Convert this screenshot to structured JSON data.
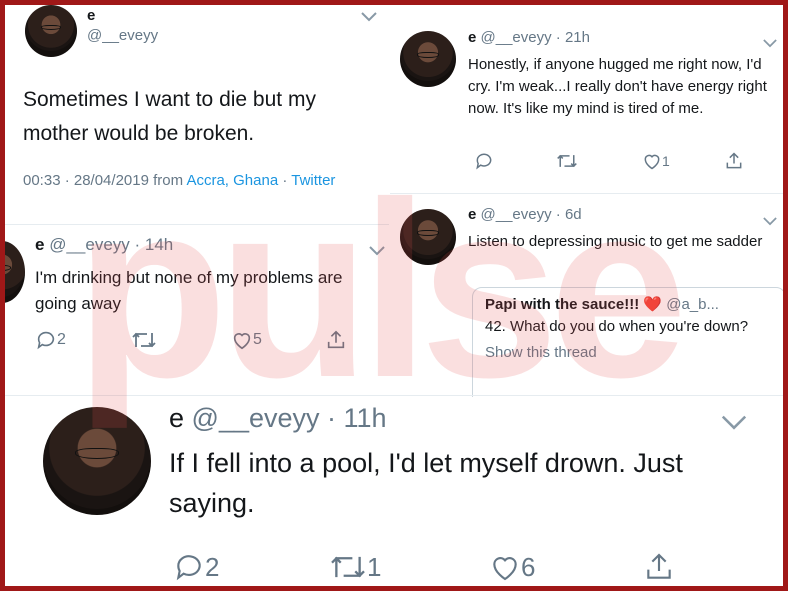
{
  "tweet_main": {
    "name": "e",
    "handle": "@__eveyy",
    "text": "Sometimes I want to die but my mother would be broken.",
    "time": "00:33 · 28/04/2019 from",
    "location": "Accra, Ghana",
    "sep": "·",
    "source": "Twitter"
  },
  "tweet_hug": {
    "name": "e",
    "meta": "@__eveyy · 21h",
    "text": "Honestly, if anyone hugged me right now, I'd cry. I'm weak...I really don't have energy right now. It's like my mind is tired of me.",
    "likes": "1"
  },
  "tweet_drinking": {
    "name": "e",
    "meta": "@__eveyy · 14h",
    "text": "I'm drinking but none of my problems are going away",
    "replies": "2",
    "likes": "5"
  },
  "tweet_music": {
    "name": "e",
    "meta": "@__eveyy · 6d",
    "text": "Listen to depressing music to get me sadder",
    "quote": {
      "author": "Papi with the sauce!!! ❤️",
      "handle": "@a_b...",
      "text": "42. What do you do when you're down?",
      "show_thread": "Show this thread"
    }
  },
  "tweet_pool": {
    "name": "e",
    "meta": "@__eveyy · 11h",
    "text": "If I fell into a pool, I'd let myself drown. Just saying.",
    "replies": "2",
    "retweets": "1",
    "likes": "6"
  },
  "watermark": "pulse",
  "colors": {
    "border": "#a01818",
    "link": "#1b95e0",
    "gray": "#657786",
    "watermark": "#e24c4c"
  }
}
